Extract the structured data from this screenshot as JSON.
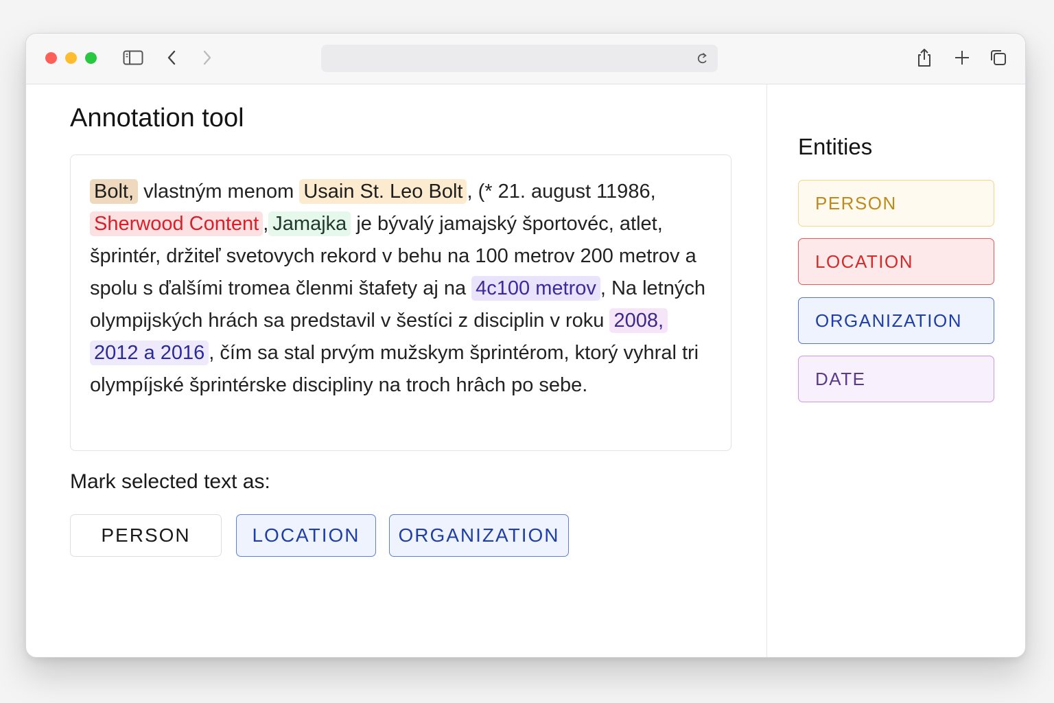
{
  "browser": {
    "url_text": "",
    "icons": [
      "sidebar-toggle-icon",
      "back-icon",
      "forward-icon",
      "reload-icon",
      "share-icon",
      "new-tab-icon",
      "tabs-overview-icon"
    ]
  },
  "main": {
    "title": "Annotation tool",
    "text": {
      "e1": "Bolt,",
      "t1": " vlastným menom ",
      "e2": "Usain St. Leo Bolt",
      "t2": ", (* 21. august 11986,",
      "e3": "Sherwood Content",
      "t3": ",",
      "e4": "Jamajka",
      "t4": " je bývalý jamajský športovéc, atlet, šprintér, držiteľ svetovych rekord v behu na 100 metrov 200 metrov a spolu s ďalšími tromea členmi štafety aj na ",
      "e5": "4c100 metrov",
      "t5": ", Na letných olympijských hrách sa predstavil v šestíci z disciplin v roku ",
      "e6": "2008,",
      "t6": " ",
      "e7": "2012 a 2016",
      "t7": ", čím sa stal prvým mužskym šprintérom, ktorý vyhral tri olympíjské šprintérske discipliny na troch hrâch po sebe."
    },
    "mark_label": "Mark selected text as:",
    "mark_buttons": [
      "PERSON",
      "LOCATION",
      "ORGANIZATION"
    ]
  },
  "sidebar": {
    "title": "Entities",
    "entities": [
      "PERSON",
      "LOCATION",
      "ORGANIZATION",
      "DATE"
    ]
  },
  "colors": {
    "person": "#c08a1a",
    "location": "#d42a2a",
    "organization": "#1f3fa6",
    "date": "#5a3a8a"
  }
}
